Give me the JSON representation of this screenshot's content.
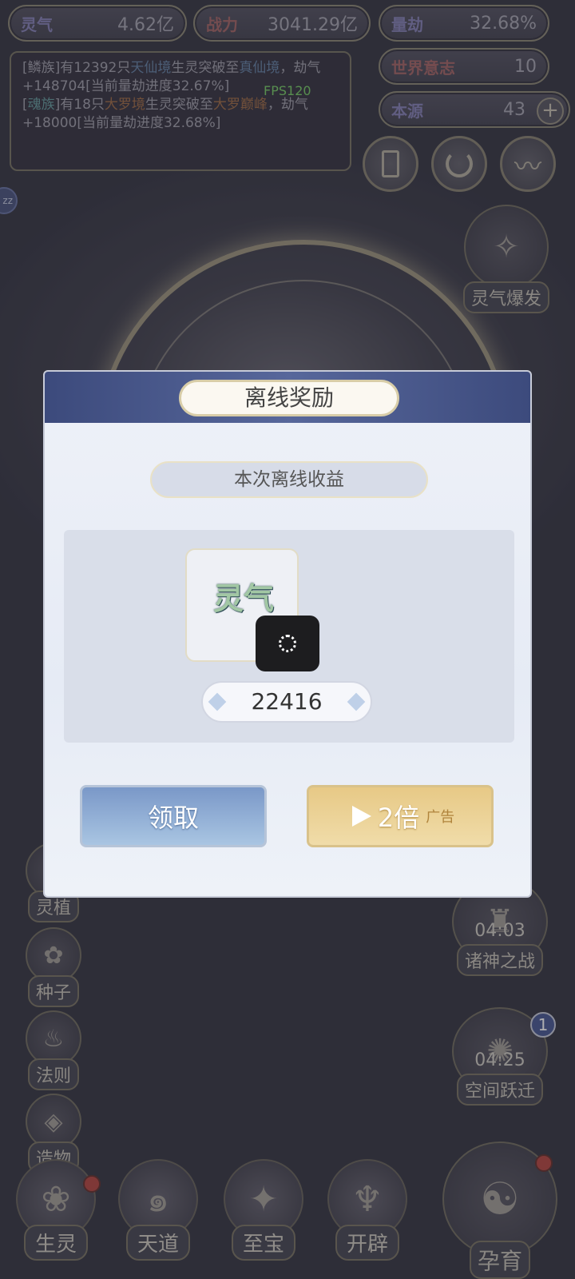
{
  "top_stats": [
    {
      "label": "灵气",
      "value": "4.62亿"
    },
    {
      "label": "战力",
      "value": "3041.29亿"
    },
    {
      "label": "量劫",
      "value": "32.68%"
    },
    {
      "label": "世界意志",
      "value": "10"
    },
    {
      "label": "本源",
      "value": "43"
    }
  ],
  "log": {
    "line1_a": "[鳞族]有12392只",
    "line1_realm": "天仙境",
    "line1_b": "生灵突破至",
    "line1_target": "真仙境",
    "line1_c": "，劫气+148704[当前量劫进度32.67%]",
    "line2_tribe": "魂族",
    "line2_a": "]有18只",
    "line2_realm": "大罗境",
    "line2_b": "生灵突破至",
    "line2_target": "大罗巅峰",
    "line2_c": "，劫气+18000[当前量劫进度32.68%]"
  },
  "fps": "FPS120",
  "zz": "zz",
  "right_buttons": {
    "burst_label": "灵气爆发",
    "war_timer": "04:03",
    "war_label": "诸神之战",
    "jump_timer": "04:25",
    "jump_label": "空间跃迁",
    "jump_badge": "1",
    "breed_label": "孕育"
  },
  "left_buttons": [
    "灵植",
    "种子",
    "法则",
    "造物"
  ],
  "bottom_nav": [
    "生灵",
    "天道",
    "至宝",
    "开辟"
  ],
  "dialog": {
    "title": "离线奖励",
    "subtitle": "本次离线收益",
    "item_name": "灵气",
    "amount": "22416",
    "claim_label": "领取",
    "double_label": "2倍",
    "ad_label": "广告"
  }
}
